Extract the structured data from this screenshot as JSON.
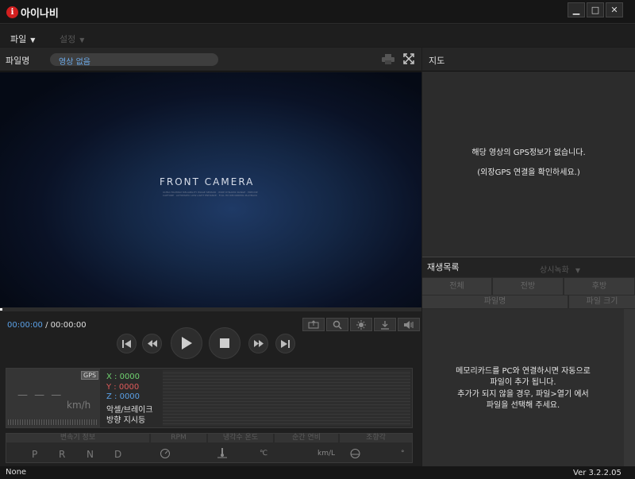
{
  "app": {
    "logo_mark": "i",
    "title": "아이나비"
  },
  "window": {
    "minimize": "▁",
    "maximize": "□",
    "close": "✕"
  },
  "menu": {
    "file": "파일",
    "settings": "설정"
  },
  "file": {
    "label": "파일명",
    "value": "영상 없음"
  },
  "video": {
    "camera_title": "FRONT CAMERA",
    "camera_sub": "ULTRA HIGHWAY RELIABILITY IMAGE SENSOR · WIDE DYNAMIC RANGE · PRECISE CAPTURE · AUTOMATIC LOW LIGHT ENHANCE · FULL HD RECORDING PLAYBACK"
  },
  "playback": {
    "current_time": "00:00:00",
    "separator": " / ",
    "total_time": "00:00:00",
    "progress": 0
  },
  "gps": {
    "badge": "GPS",
    "speed": "— — —",
    "unit": "km/h",
    "x": "X : 0000",
    "y": "Y : 0000",
    "z": "Z : 0000",
    "accel": "악셀/브레이크",
    "direction": "방향 지시등"
  },
  "obd": {
    "headers": [
      "변속기 정보",
      "RPM",
      "냉각수 온도",
      "순간 연비",
      "조향각"
    ],
    "gears": [
      "P",
      "R",
      "N",
      "D"
    ],
    "temp_unit": "℃",
    "fuel_unit": "km/L",
    "angle_unit": "°"
  },
  "map": {
    "title": "지도",
    "msg1": "해당 영상의 GPS정보가 없습니다.",
    "msg2": "(외장GPS 연결을 확인하세요.)"
  },
  "playlist": {
    "title": "재생목록",
    "filter": "상시녹화",
    "tabs": [
      "전체",
      "전방",
      "후방"
    ],
    "col_name": "파일명",
    "col_size": "파일 크기",
    "msg1": "메모리카드를 PC와 연결하시면 자동으로",
    "msg2": "파일이 추가 됩니다.",
    "msg3": "추가가 되지 않을 경우, 파일>열기 에서",
    "msg4": "파일을 선택해 주세요."
  },
  "status": {
    "left": "None",
    "version": "Ver 3.2.2.05"
  },
  "colors": {
    "accent": "#5aa0e6",
    "x": "#6fd26f",
    "y": "#e05a5a",
    "z": "#5aa0e6"
  }
}
